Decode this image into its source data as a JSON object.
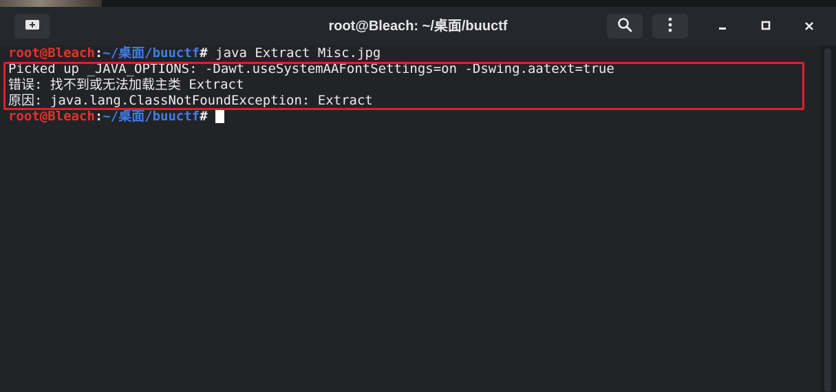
{
  "window": {
    "title": "root@Bleach: ~/桌面/buuctf"
  },
  "titlebar": {
    "new_tab_icon": "new-tab-icon",
    "search_icon": "search-icon",
    "menu_icon": "kebab-menu-icon",
    "minimize_icon": "minimize-icon",
    "maximize_icon": "maximize-icon",
    "close_icon": "close-icon"
  },
  "terminal": {
    "prompt": {
      "user_host": "root@Bleach",
      "colon": ":",
      "path": "~/桌面/buuctf",
      "hash": "#"
    },
    "command": " java Extract Misc.jpg",
    "output": [
      "Picked up _JAVA_OPTIONS: -Dawt.useSystemAAFontSettings=on -Dswing.aatext=true",
      "错误: 找不到或无法加载主类 Extract",
      "原因: java.lang.ClassNotFoundException: Extract"
    ],
    "next_prompt_input": " "
  },
  "colors": {
    "prompt_user": "#e8302b",
    "prompt_path": "#3f7de8",
    "highlight_border": "#e0202a",
    "background": "#222327"
  }
}
